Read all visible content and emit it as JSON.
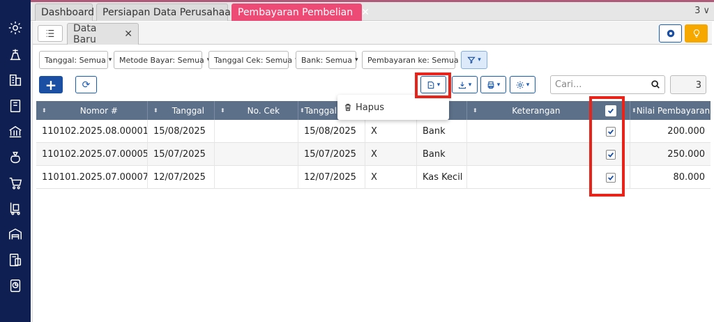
{
  "tabs": [
    {
      "label": "Dashboard"
    },
    {
      "label": "Persiapan Data Perusahaan"
    },
    {
      "label": "Pembayaran Pembelian",
      "active": true
    }
  ],
  "tab_overflow": "3 ∨",
  "subtab": {
    "label": "Data Baru"
  },
  "filters": [
    {
      "label": "Tanggal: Semua"
    },
    {
      "label": "Metode Bayar: Semua"
    },
    {
      "label": "Tanggal Cek: Semua"
    },
    {
      "label": "Bank: Semua"
    },
    {
      "label": "Pembayaran ke: Semua"
    }
  ],
  "toolbar": {
    "add_label": "+",
    "refresh_label": "⟳"
  },
  "search": {
    "placeholder": "Cari..."
  },
  "record_count": "3",
  "dropdown": {
    "delete_label": "Hapus"
  },
  "columns": {
    "nomor": "Nomor #",
    "tanggal": "Tanggal",
    "no_cek": "No. Cek",
    "tanggal_cek": "Tanggal",
    "keterangan": "Keterangan",
    "nilai": "Nilai Pembayaran"
  },
  "rows": [
    {
      "nomor": "110102.2025.08.00001",
      "tanggal": "15/08/2025",
      "no_cek": "",
      "tanggal_cek": "15/08/2025",
      "flag": "X",
      "bank": "Bank",
      "keterangan": "",
      "checked": true,
      "nilai": "200.000"
    },
    {
      "nomor": "110102.2025.07.00005",
      "tanggal": "15/07/2025",
      "no_cek": "",
      "tanggal_cek": "15/07/2025",
      "flag": "X",
      "bank": "Bank",
      "keterangan": "",
      "checked": true,
      "nilai": "250.000"
    },
    {
      "nomor": "110101.2025.07.00007",
      "tanggal": "12/07/2025",
      "no_cek": "",
      "tanggal_cek": "12/07/2025",
      "flag": "X",
      "bank": "Kas Kecil",
      "keterangan": "",
      "checked": true,
      "nilai": "80.000"
    }
  ],
  "colors": {
    "accent": "#1a4fa3",
    "active_tab": "#ee4a76",
    "sidebar": "#0f1f52",
    "highlight": "#e8231a",
    "header": "#5c7089"
  }
}
